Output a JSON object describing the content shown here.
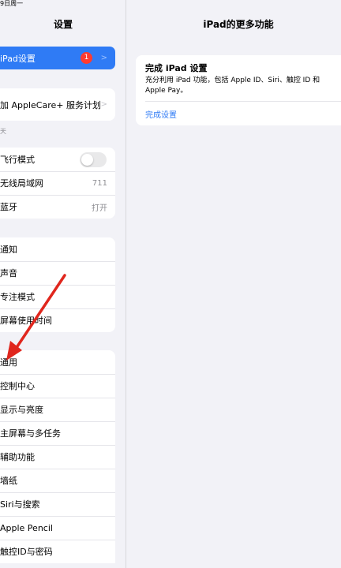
{
  "status_bar": {
    "date": "9日周一"
  },
  "sidebar": {
    "title": "设置",
    "ipad_setup": {
      "label": "iPad设置",
      "badge": "1"
    },
    "applecare": {
      "label": "加 AppleCare+ 服务计划"
    },
    "section_label": "天",
    "network": [
      {
        "label": "飞行模式",
        "toggle": false
      },
      {
        "label": "无线局域网",
        "value": "711"
      },
      {
        "label": "蓝牙",
        "value": "打开"
      }
    ],
    "notifications": [
      {
        "label": "通知"
      },
      {
        "label": "声音"
      },
      {
        "label": "专注模式"
      },
      {
        "label": "屏幕使用时间"
      }
    ],
    "general": [
      {
        "label": "通用"
      },
      {
        "label": "控制中心"
      },
      {
        "label": "显示与亮度"
      },
      {
        "label": "主屏幕与多任务"
      },
      {
        "label": "辅助功能"
      },
      {
        "label": "墙纸"
      },
      {
        "label": "Siri与搜索"
      },
      {
        "label": "Apple Pencil"
      },
      {
        "label": "触控ID与密码"
      }
    ]
  },
  "main": {
    "title": "iPad的更多功能",
    "card": {
      "title": "完成 iPad 设置",
      "description": "充分利用 iPad 功能，包括 Apple ID、Siri、触控 ID 和 Apple Pay。",
      "action": "完成设置"
    }
  },
  "colors": {
    "accent": "#2f7bf5",
    "badge": "#ff3b30",
    "arrow": "#e0261d"
  }
}
